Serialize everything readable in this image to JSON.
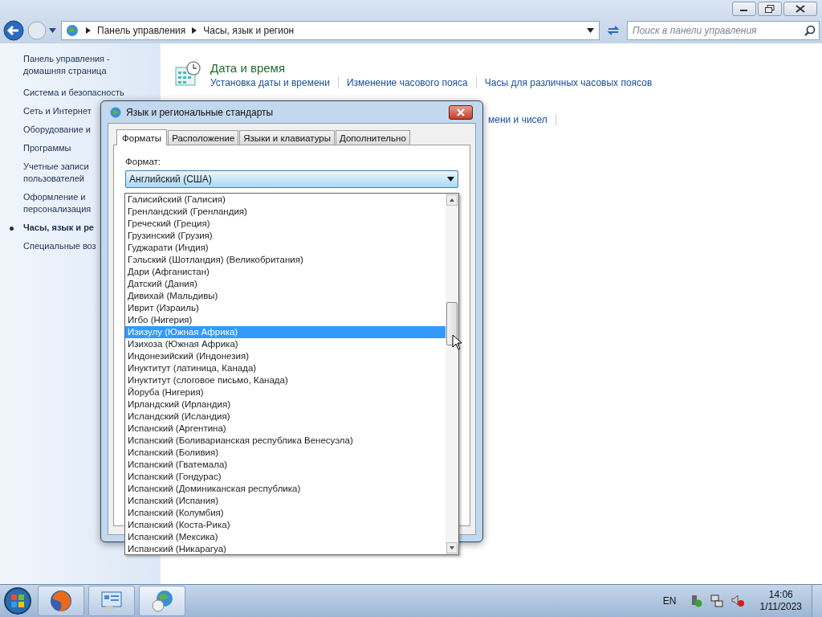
{
  "explorer": {
    "breadcrumb": [
      "Панель управления",
      "Часы, язык и регион"
    ],
    "search": {
      "placeholder": "Поиск в панели управления"
    }
  },
  "sidebar": {
    "items": [
      {
        "label": "Панель управления - домашняя страница",
        "selected": false
      },
      {
        "label": "Система и безопасность",
        "selected": false
      },
      {
        "label": "Сеть и Интернет",
        "selected": false
      },
      {
        "label": "Оборудование и",
        "selected": false
      },
      {
        "label": "Программы",
        "selected": false
      },
      {
        "label": "Учетные записи пользователей",
        "selected": false
      },
      {
        "label": "Оформление и персонализация",
        "selected": false
      },
      {
        "label": "Часы, язык и ре",
        "selected": true
      },
      {
        "label": "Специальные воз",
        "selected": false
      }
    ]
  },
  "section": {
    "title": "Дата и время",
    "links": [
      "Установка даты и времени",
      "Изменение часового пояса",
      "Часы для различных часовых поясов"
    ],
    "hidden_link": "мени и чисел"
  },
  "dialog": {
    "title": "Язык и региональные стандарты",
    "tabs": [
      {
        "label": "Форматы",
        "selected": true
      },
      {
        "label": "Расположение",
        "selected": false
      },
      {
        "label": "Языки и клавиатуры",
        "selected": false
      },
      {
        "label": "Дополнительно",
        "selected": false
      }
    ],
    "format_label": "Формат:",
    "format_value": "Английский (США)",
    "options": [
      {
        "label": "Галисийский (Галисия)",
        "selected": false
      },
      {
        "label": "Гренландский (Гренландия)",
        "selected": false
      },
      {
        "label": "Греческий (Греция)",
        "selected": false
      },
      {
        "label": "Грузинский (Грузия)",
        "selected": false
      },
      {
        "label": "Гуджарати (Индия)",
        "selected": false
      },
      {
        "label": "Гэльский (Шотландия) (Великобритания)",
        "selected": false
      },
      {
        "label": "Дари (Афганистан)",
        "selected": false
      },
      {
        "label": "Датский (Дания)",
        "selected": false
      },
      {
        "label": "Дивихай (Мальдивы)",
        "selected": false
      },
      {
        "label": "Иврит (Израиль)",
        "selected": false
      },
      {
        "label": "Игбо (Нигерия)",
        "selected": false
      },
      {
        "label": "Изизулу (Южная Африка)",
        "selected": true
      },
      {
        "label": "Изихоза (Южная Африка)",
        "selected": false
      },
      {
        "label": "Индонезийский (Индонезия)",
        "selected": false
      },
      {
        "label": "Инуктитут (латиница, Канада)",
        "selected": false
      },
      {
        "label": "Инуктитут (слоговое письмо, Канада)",
        "selected": false
      },
      {
        "label": "Йоруба (Нигерия)",
        "selected": false
      },
      {
        "label": "Ирландский (Ирландия)",
        "selected": false
      },
      {
        "label": "Исландский (Исландия)",
        "selected": false
      },
      {
        "label": "Испанский (Аргентина)",
        "selected": false
      },
      {
        "label": "Испанский (Боливарианская республика Венесуэла)",
        "selected": false
      },
      {
        "label": "Испанский (Боливия)",
        "selected": false
      },
      {
        "label": "Испанский (Гватемала)",
        "selected": false
      },
      {
        "label": "Испанский (Гондурас)",
        "selected": false
      },
      {
        "label": "Испанский (Доминиканская республика)",
        "selected": false
      },
      {
        "label": "Испанский (Испания)",
        "selected": false
      },
      {
        "label": "Испанский (Колумбия)",
        "selected": false
      },
      {
        "label": "Испанский (Коста-Рика)",
        "selected": false
      },
      {
        "label": "Испанский (Мексика)",
        "selected": false
      },
      {
        "label": "Испанский (Никарагуа)",
        "selected": false
      }
    ]
  },
  "taskbar": {
    "language": "EN",
    "time": "14:06",
    "date": "1/11/2023"
  }
}
